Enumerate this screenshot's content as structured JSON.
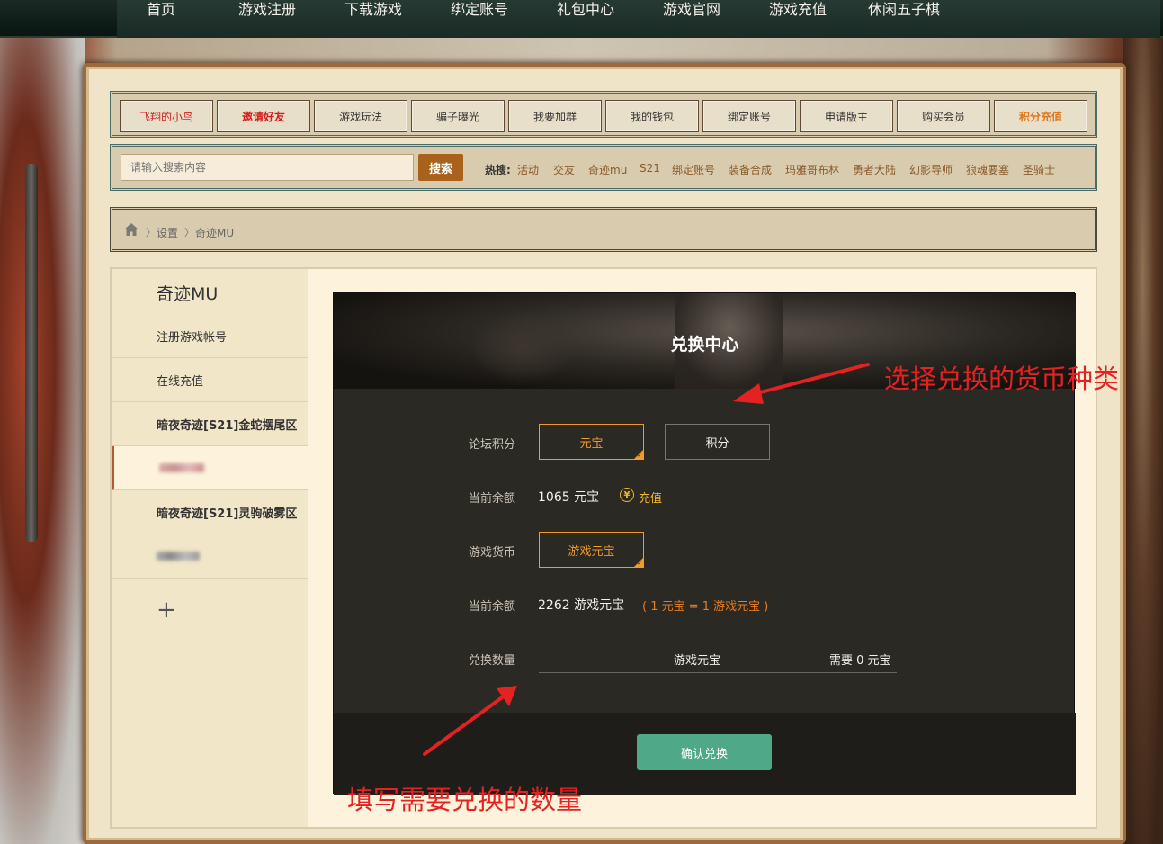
{
  "top_nav": {
    "items": [
      "首页",
      "游戏注册",
      "下载游戏",
      "绑定账号",
      "礼包中心",
      "游戏官网",
      "游戏充值",
      "休闲五子棋"
    ]
  },
  "link_bar": {
    "items": [
      "飞翔的小鸟",
      "邀请好友",
      "游戏玩法",
      "骗子曝光",
      "我要加群",
      "我的钱包",
      "绑定账号",
      "申请版主",
      "购买会员",
      "积分充值"
    ]
  },
  "search": {
    "placeholder": "请输入搜索内容",
    "button": "搜索",
    "hot_label": "热搜:",
    "hot_items": [
      "活动",
      "交友",
      "奇迹mu",
      "S21",
      "绑定账号",
      "装备合成",
      "玛雅哥布林",
      "勇者大陆",
      "幻影导师",
      "狼魂要塞",
      "圣骑士"
    ]
  },
  "breadcrumb": {
    "items": [
      "设置",
      "奇迹MU"
    ]
  },
  "sidebar": {
    "title": "奇迹MU",
    "items": [
      "注册游戏帐号",
      "在线充值",
      "暗夜奇迹[S21]金蛇摆尾区",
      "",
      "暗夜奇迹[S21]灵驹破雾区",
      ""
    ],
    "plus": "+"
  },
  "exchange": {
    "title": "兑换中心",
    "forum_points_label": "论坛积分",
    "options": [
      "元宝",
      "积分"
    ],
    "balance_label": "当前余额",
    "balance_value": "1065 元宝",
    "recharge_icon": "¥",
    "recharge_label": "充值",
    "game_currency_label": "游戏货币",
    "game_currency_option": "游戏元宝",
    "game_balance_label": "当前余额",
    "game_balance_value": "2262 游戏元宝",
    "rate": "( 1 元宝 = 1 游戏元宝 )",
    "quantity_label": "兑换数量",
    "quantity_unit": "游戏元宝",
    "need_text": "需要 0 元宝",
    "confirm_button": "确认兑换"
  },
  "annotations": {
    "currency_hint": "选择兑换的货币种类",
    "quantity_hint": "填写需要兑换的数量"
  },
  "colors": {
    "accent_orange": "#f29a2a",
    "confirm_green": "#4fa888",
    "annotation_red": "#e52222",
    "panel_dark": "#2b2924"
  }
}
